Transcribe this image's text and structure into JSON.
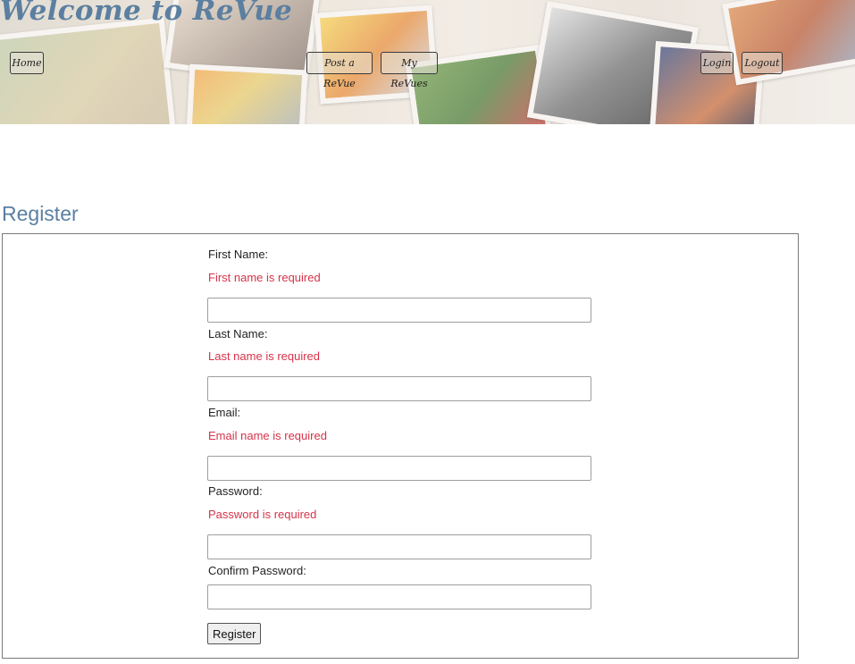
{
  "header": {
    "title": "Welcome to ReVue",
    "nav": {
      "home": "Home",
      "post": "Post a ReVue",
      "my_revues": "My ReVues",
      "login": "Login",
      "logout": "Logout"
    }
  },
  "page": {
    "heading": "Register"
  },
  "form": {
    "first_name_label": "First Name:",
    "first_name_error": "First name is required",
    "first_name_value": "",
    "last_name_label": "Last Name:",
    "last_name_error": "Last name is required",
    "last_name_value": "",
    "email_label": "Email:",
    "email_error": "Email name is required",
    "email_value": "",
    "password_label": "Password:",
    "password_error": "Password is required",
    "password_value": "",
    "confirm_password_label": "Confirm Password:",
    "confirm_password_value": "",
    "submit_label": "Register"
  },
  "colors": {
    "accent": "#5b7fa0",
    "error": "#d6334a"
  }
}
